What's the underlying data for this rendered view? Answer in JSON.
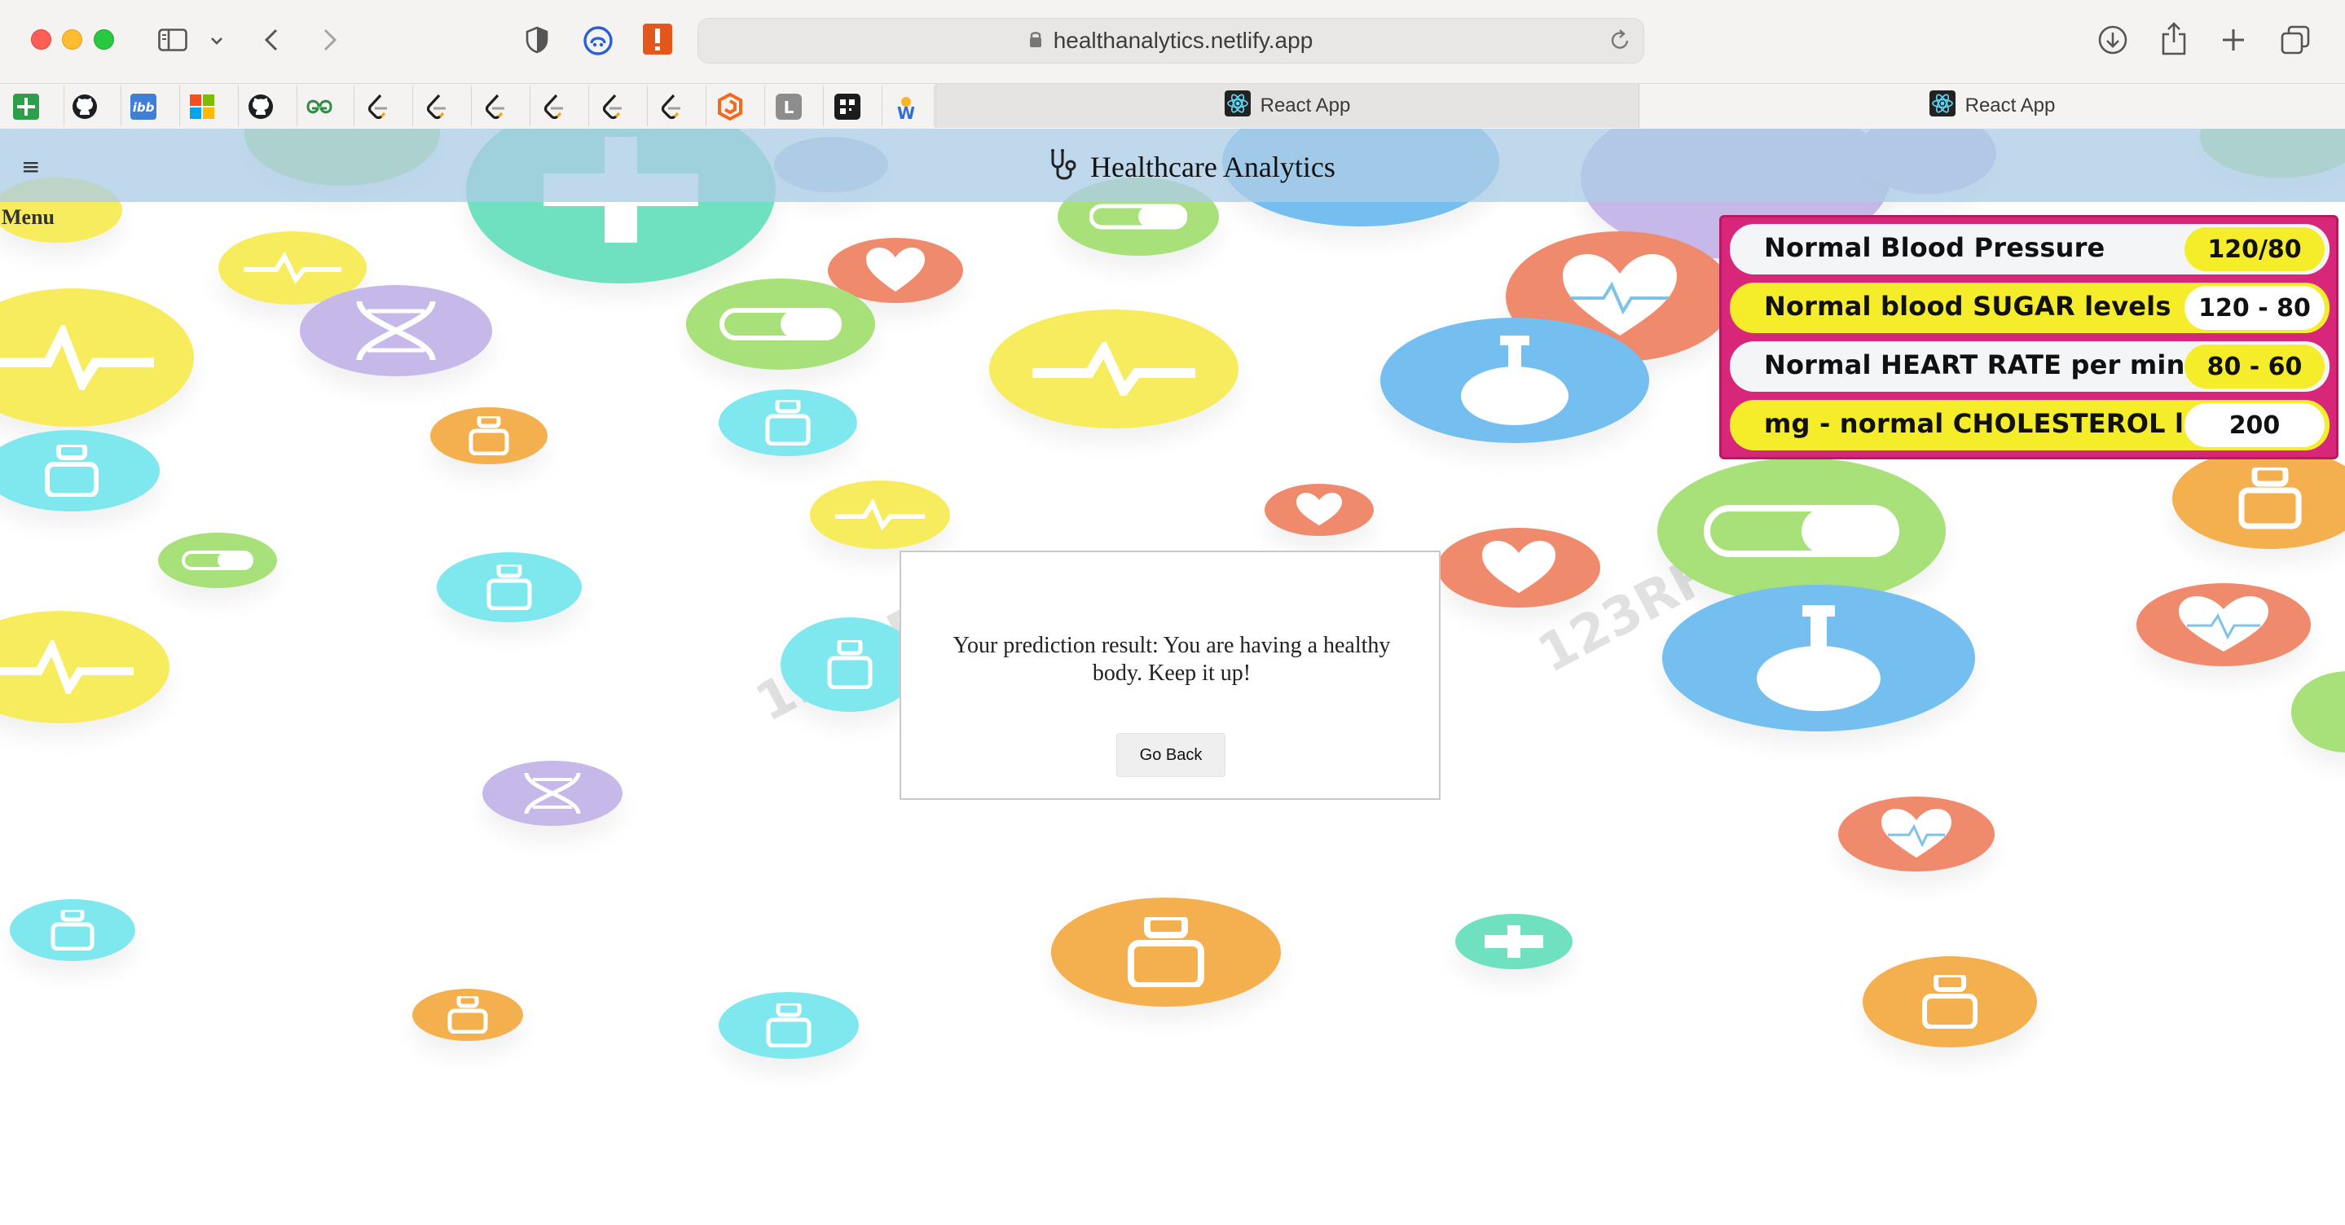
{
  "browser": {
    "url": "healthanalytics.netlify.app",
    "tabs": [
      {
        "title": "React App"
      },
      {
        "title": "React App"
      }
    ],
    "bookmarks": [
      {
        "icon": "green-plus-icon"
      },
      {
        "icon": "github-icon"
      },
      {
        "icon": "ibb-icon",
        "label": "ibb"
      },
      {
        "icon": "microsoft-icon"
      },
      {
        "icon": "github-icon"
      },
      {
        "icon": "geeksforgeeks-icon"
      },
      {
        "icon": "leetcode-icon"
      },
      {
        "icon": "leetcode-icon"
      },
      {
        "icon": "leetcode-icon"
      },
      {
        "icon": "leetcode-icon"
      },
      {
        "icon": "leetcode-icon"
      },
      {
        "icon": "leetcode-icon"
      },
      {
        "icon": "orange-hexagon-icon"
      },
      {
        "icon": "letter-l-icon",
        "label": "L"
      },
      {
        "icon": "dark-square-icon"
      },
      {
        "icon": "letter-w-icon",
        "label": "W"
      }
    ]
  },
  "header": {
    "menu_icon": "≡",
    "menu_label": "Menu",
    "title": "Healthcare Analytics"
  },
  "info_board": {
    "rows": [
      {
        "label": "Normal Blood Pressure",
        "value": "120/80"
      },
      {
        "label": "Normal blood SUGAR levels",
        "value": "120 - 80"
      },
      {
        "label": "Normal HEART RATE per minute",
        "value": "80 - 60"
      },
      {
        "label": "mg - normal CHOLESTEROL level",
        "value": "200"
      }
    ]
  },
  "result": {
    "message": "Your prediction result: You are having a healthy body. Keep it up!",
    "button_label": "Go Back"
  },
  "colors": {
    "header_bg": "#adcde6",
    "board_pink": "#d8267a",
    "board_yellow": "#f5ec2a"
  }
}
